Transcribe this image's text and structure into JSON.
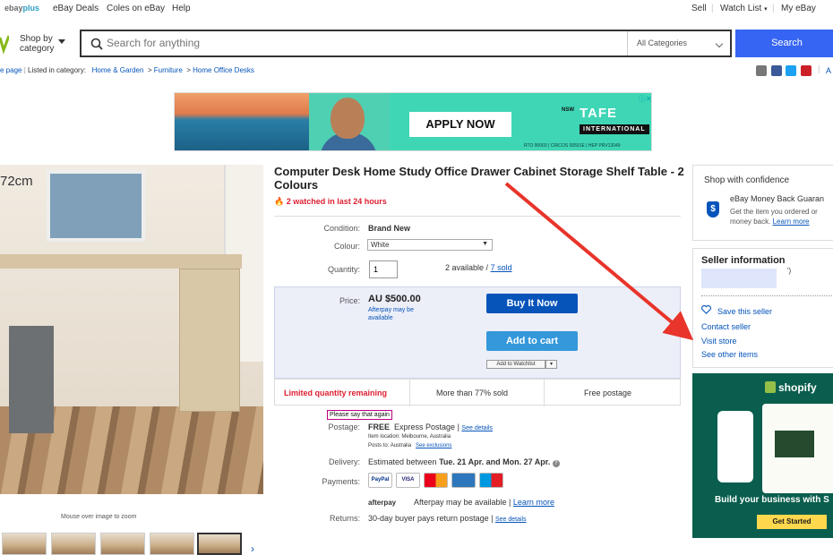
{
  "topnav": {
    "ebayplus_a": "ebay",
    "ebayplus_b": "plus",
    "deals": "eBay Deals",
    "coles": "Coles on eBay",
    "help": "Help",
    "sell": "Sell",
    "watchlist": "Watch List",
    "myebay": "My eBay"
  },
  "search": {
    "shop_by": "Shop by",
    "category": "category",
    "placeholder": "Search for anything",
    "category_select": "All Categories",
    "button": "Search"
  },
  "breadcrumb": {
    "back": "e page",
    "listed_in": "Listed in category:",
    "items": [
      "Home & Garden",
      "Furniture",
      "Home Office Desks"
    ]
  },
  "ad": {
    "cta": "APPLY NOW",
    "brand": "TAFE",
    "brand_sub": "INTERNATIONAL",
    "state": "NSW",
    "footer": "RTO 90003 | CRICOS 00591E | HEP PRV12049"
  },
  "product_image": {
    "dimension": "72cm",
    "zoom_note": "Mouse over image to zoom",
    "thumbnail_count": 5
  },
  "product": {
    "title": "Computer Desk Home Study Office Drawer Cabinet Storage Shelf Table - 2 Colours",
    "watched": "2 watched in last 24 hours",
    "condition_label": "Condition:",
    "condition": "Brand New",
    "color_label": "Colour:",
    "color": "White",
    "quantity_label": "Quantity:",
    "quantity": "1",
    "available": "2 available /",
    "sold": "7 sold",
    "price_label": "Price:",
    "price": "AU $500.00",
    "afterpay_note": "Afterpay may be available",
    "buy_now": "Buy It Now",
    "add_to_cart": "Add to cart",
    "add_to_watchlist": "Add to Watchlist",
    "limited": "Limited quantity remaining",
    "sold_pct": "More than 77% sold",
    "free_postage": "Free postage",
    "tooltip": "Please say that again",
    "postage_label": "Postage:",
    "postage_free": "FREE",
    "postage_type": "Express Postage |",
    "see_details": "See details",
    "item_location": "Item location:",
    "item_location_val": "Melbourne, Australia",
    "posts_to": "Posts to:",
    "posts_to_val": "Australia",
    "see_exclusions": "See exclusions",
    "delivery_label": "Delivery:",
    "delivery_prefix": "Estimated between",
    "delivery_dates": "Tue. 21 Apr. and Mon. 27 Apr.",
    "payments_label": "Payments:",
    "payment_methods": [
      "PayPal",
      "VISA",
      "MC",
      "AMEX",
      "Maestro"
    ],
    "afterpay_logo": "afterpay",
    "afterpay_text": "Afterpay may be available |",
    "learn_more": "Learn more",
    "returns_label": "Returns:",
    "returns": "30-day buyer pays return postage |",
    "returns_details": "See details"
  },
  "confidence": {
    "title": "Shop with confidence",
    "guarantee": "eBay Money Back Guaran",
    "desc_1": "Get the item you ordered or",
    "desc_2": "money back.",
    "learn_more": "Learn more"
  },
  "seller": {
    "title": "Seller information",
    "feedback": "')",
    "save": "Save this seller",
    "contact": "Contact seller",
    "store": "Visit store",
    "other": "See other items"
  },
  "shopify_ad": {
    "brand": "shopify",
    "tagline": "Build your business with S",
    "cta": "Get Started"
  },
  "colors": {
    "link": "#0654ba",
    "buy_now": "#0654ba",
    "add_to_cart": "#3498db",
    "search_btn": "#3665f3",
    "alert_red": "#dd1e31",
    "annotation_arrow": "#e8342a",
    "shopify_bg": "#0a5e4d"
  }
}
